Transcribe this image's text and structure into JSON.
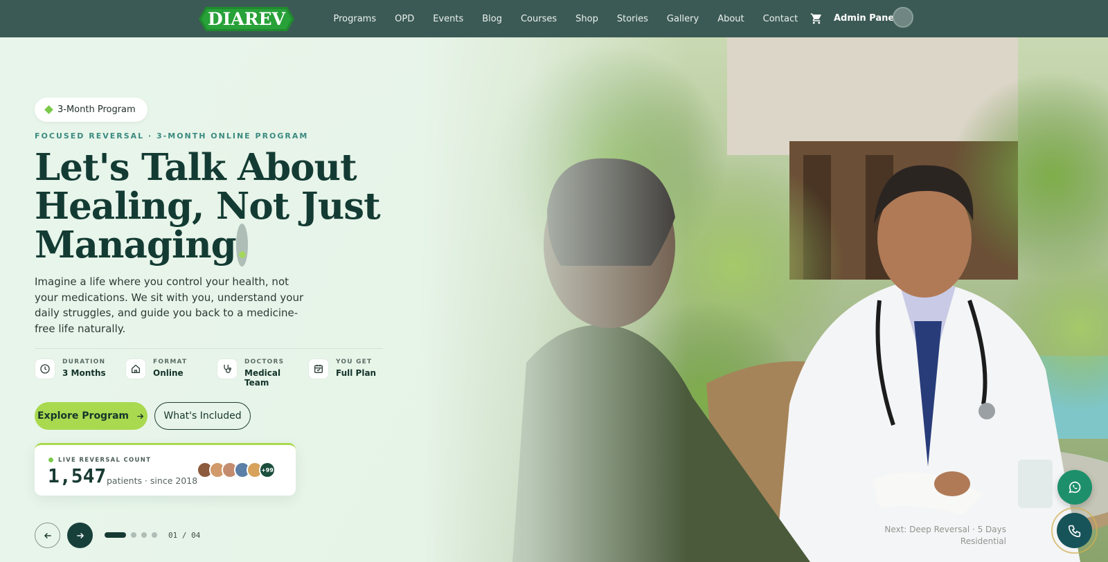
{
  "brand": {
    "logo_text": "DIAREV"
  },
  "nav": {
    "links": [
      "Programs",
      "OPD",
      "Events",
      "Blog",
      "Courses",
      "Shop",
      "Stories",
      "Gallery",
      "About",
      "Contact"
    ],
    "admin_label": "Admin Panel"
  },
  "hero": {
    "pill": "3-Month Program",
    "eyebrow": "FOCUSED REVERSAL · 3-MONTH ONLINE PROGRAM",
    "headline_line1": "Let's Talk About",
    "headline_line2": "Healing, Not Just",
    "headline_line3": "Managing",
    "headline_dot": ".",
    "lead": "Imagine a life where you control your health, not your medications. We sit with you, understand your daily struggles, and guide you back to a medicine-free life naturally.",
    "stats": [
      {
        "label": "DURATION",
        "value": "3 Months",
        "icon": "clock-icon"
      },
      {
        "label": "FORMAT",
        "value": "Online",
        "icon": "home-icon"
      },
      {
        "label": "DOCTORS",
        "value": "Medical Team",
        "icon": "stethoscope-icon"
      },
      {
        "label": "YOU GET",
        "value": "Full Plan",
        "icon": "calendar-icon"
      }
    ],
    "primary_cta": "Explore Program",
    "secondary_cta": "What's Included"
  },
  "counter_card": {
    "label": "LIVE REVERSAL COUNT",
    "count": "1,547",
    "subtitle": "patients · since 2018",
    "more_badge": "+99"
  },
  "slider": {
    "counter": "01 / 04",
    "active_index": 1,
    "total": 4
  },
  "next_slide": {
    "prefix": "Next:",
    "title": "Deep Reversal · 5 Days",
    "line2": "Residential"
  },
  "colors": {
    "nav_bg": "#3c5a55",
    "accent": "#a9d94f",
    "dark": "#17403a",
    "whatsapp": "#1e8f6b"
  }
}
